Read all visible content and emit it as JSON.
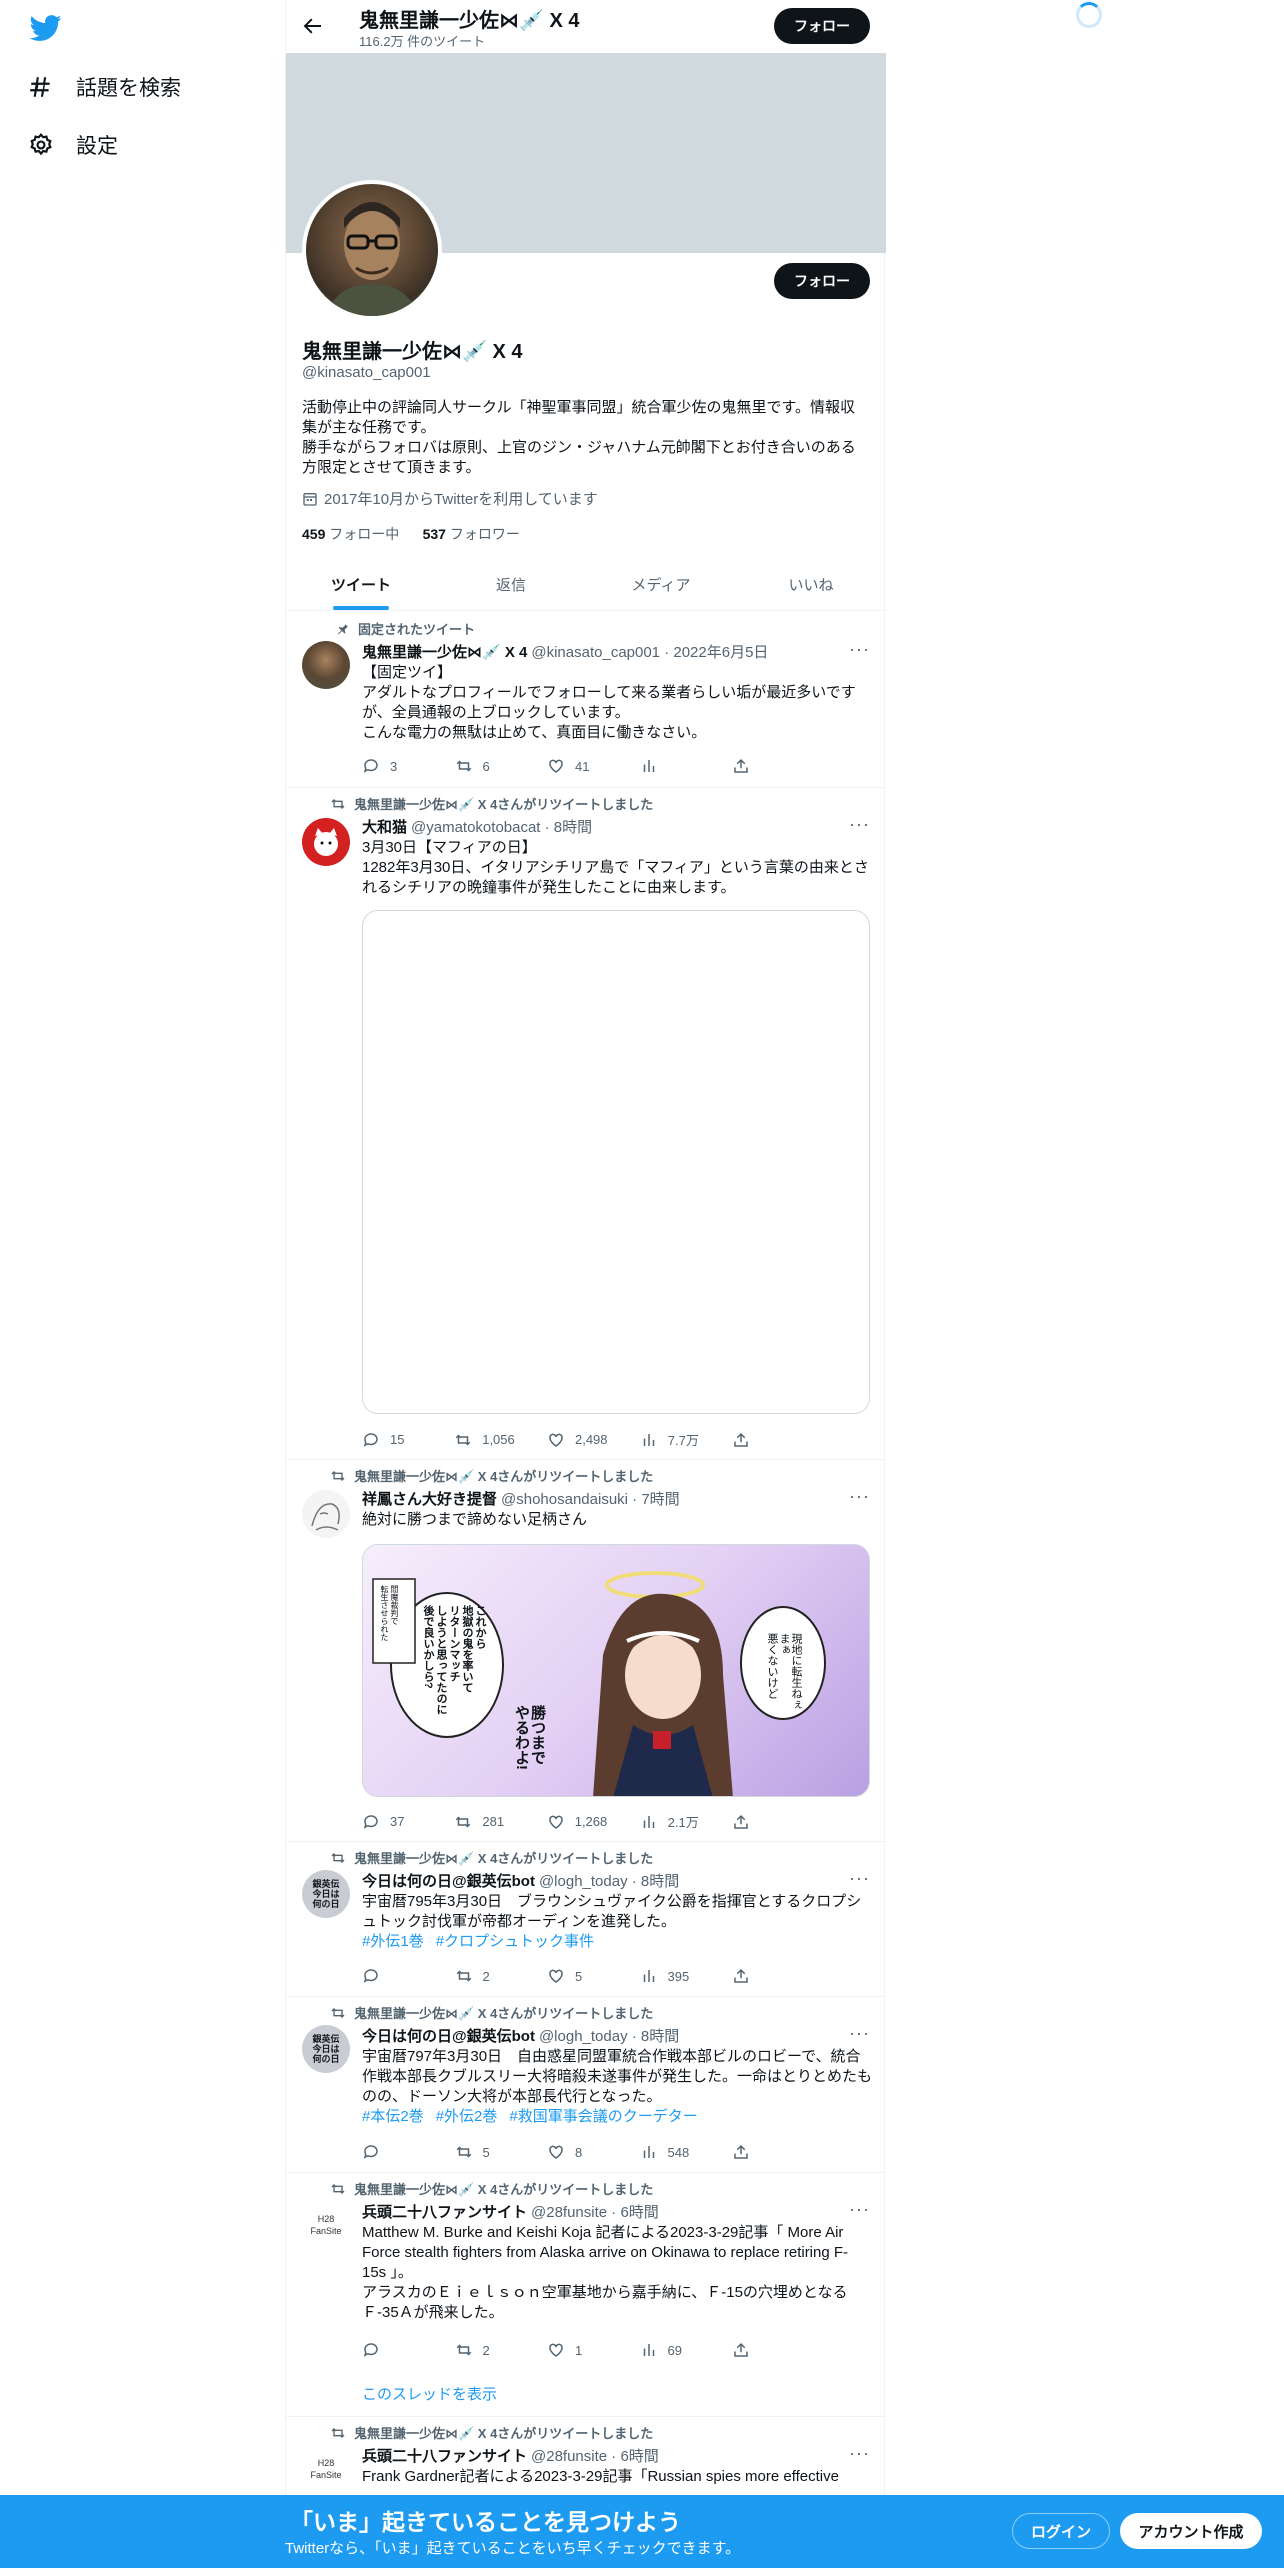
{
  "nav": {
    "search_label": "話題を検索",
    "settings_label": "設定"
  },
  "header": {
    "name": "鬼無里謙一少佐⋈💉 X 4",
    "tweet_count": "116.2万 件のツイート",
    "follow_label": "フォロー"
  },
  "profile": {
    "name": "鬼無里謙一少佐⋈💉 X 4",
    "handle": "@kinasato_cap001",
    "bio": "活動停止中の評論同人サークル「神聖軍事同盟」統合軍少佐の鬼無里です。情報収集が主な任務です。\n勝手ながらフォロバは原則、上官のジン・ジャハナム元帥閣下とお付き合いのある方限定とさせて頂きます。",
    "joined": "2017年10月からTwitterを利用しています",
    "following_count": "459",
    "following_label": "フォロー中",
    "followers_count": "537",
    "followers_label": "フォロワー",
    "follow_label": "フォロー"
  },
  "tabs": [
    "ツイート",
    "返信",
    "メディア",
    "いいね"
  ],
  "tweets": [
    {
      "context": "固定されたツイート",
      "name": "鬼無里謙一少佐⋈💉 X 4",
      "meta": "@kinasato_cap001 · 2022年6月5日",
      "text": "【固定ツイ】\nアダルトなプロフィールでフォローして来る業者らしい垢が最近多いですが、全員通報の上ブロックしています。\nこんな電力の無駄は止めて、真面目に働きなさい。",
      "replies": "3",
      "retweets": "6",
      "likes": "41",
      "views": ""
    },
    {
      "context": "鬼無里謙一少佐⋈💉 X 4さんがリツイートしました",
      "name": "大和猫",
      "meta": "@yamatokotobacat · 8時間",
      "text": "3月30日【マフィアの日】\n1282年3月30日、イタリアシチリア島で「マフィア」という言葉の由来とされるシチリアの晩鐘事件が発生したことに由来します。",
      "replies": "15",
      "retweets": "1,056",
      "likes": "2,498",
      "views": "7.7万"
    },
    {
      "context": "鬼無里謙一少佐⋈💉 X 4さんがリツイートしました",
      "name": "祥鳳さん大好き提督",
      "meta": "@shohosandaisuki · 7時間",
      "text": "絶対に勝つまで諦めない足柄さん",
      "replies": "37",
      "retweets": "281",
      "likes": "1,268",
      "views": "2.1万",
      "image_text": {
        "a": "現地に転生ねぇ\nまぁ\n悪くないけど",
        "b": "これから\n地獄の鬼を率いて\nリターンマッチ\nしようと思ってたのに\n後で良いかしら?",
        "c": "勝つまで\nやるわよ!",
        "d": "閻魔裁判で\n転生させられた"
      }
    },
    {
      "context": "鬼無里謙一少佐⋈💉 X 4さんがリツイートしました",
      "name": "今日は何の日@銀英伝bot",
      "meta": "@logh_today · 8時間",
      "text": "宇宙暦795年3月30日　ブラウンシュヴァイク公爵を指揮官とするクロプシュトック討伐軍が帝都オーディンを進発した。",
      "hashtags": [
        "#外伝1巻",
        "#クロプシュトック事件"
      ],
      "replies": "",
      "retweets": "2",
      "likes": "5",
      "views": "395",
      "avatar_text": "銀英伝\n今日は\n何の日"
    },
    {
      "context": "鬼無里謙一少佐⋈💉 X 4さんがリツイートしました",
      "name": "今日は何の日@銀英伝bot",
      "meta": "@logh_today · 8時間",
      "text": "宇宙暦797年3月30日　自由惑星同盟軍統合作戦本部ビルのロビーで、統合作戦本部長クブルスリー大将暗殺未遂事件が発生した。一命はとりとめたものの、ドーソン大将が本部長代行となった。",
      "hashtags": [
        "#本伝2巻",
        "#外伝2巻",
        "#救国軍事会議のクーデター"
      ],
      "replies": "",
      "retweets": "5",
      "likes": "8",
      "views": "548",
      "avatar_text": "銀英伝\n今日は\n何の日"
    },
    {
      "context": "鬼無里謙一少佐⋈💉 X 4さんがリツイートしました",
      "name": "兵頭二十八ファンサイト",
      "meta": "@28funsite · 6時間",
      "text": "Matthew M. Burke and Keishi Koja 記者による2023-3-29記事「 More Air Force stealth fighters from Alaska arrive on Okinawa to replace retiring F-15s 」。\nアラスカのＥｉｅｌｓｏｎ空軍基地から嘉手納に、Ｆ-15の穴埋めとなるＦ-35Ａが飛来した。",
      "replies": "",
      "retweets": "2",
      "likes": "1",
      "views": "69",
      "thread_link": "このスレッドを表示",
      "avatar_text": "H28\nFanSite"
    },
    {
      "context": "鬼無里謙一少佐⋈💉 X 4さんがリツイートしました",
      "name": "兵頭二十八ファンサイト",
      "meta": "@28funsite · 6時間",
      "text": "Frank Gardner記者による2023-3-29記事「Russian spies more effective",
      "avatar_text": "H28\nFanSite"
    }
  ],
  "bottom": {
    "title": "「いま」起きていることを見つけよう",
    "subtitle": "Twitterなら、「いま」起きていることをいち早くチェックできます。",
    "login_label": "ログイン",
    "signup_label": "アカウント作成"
  }
}
